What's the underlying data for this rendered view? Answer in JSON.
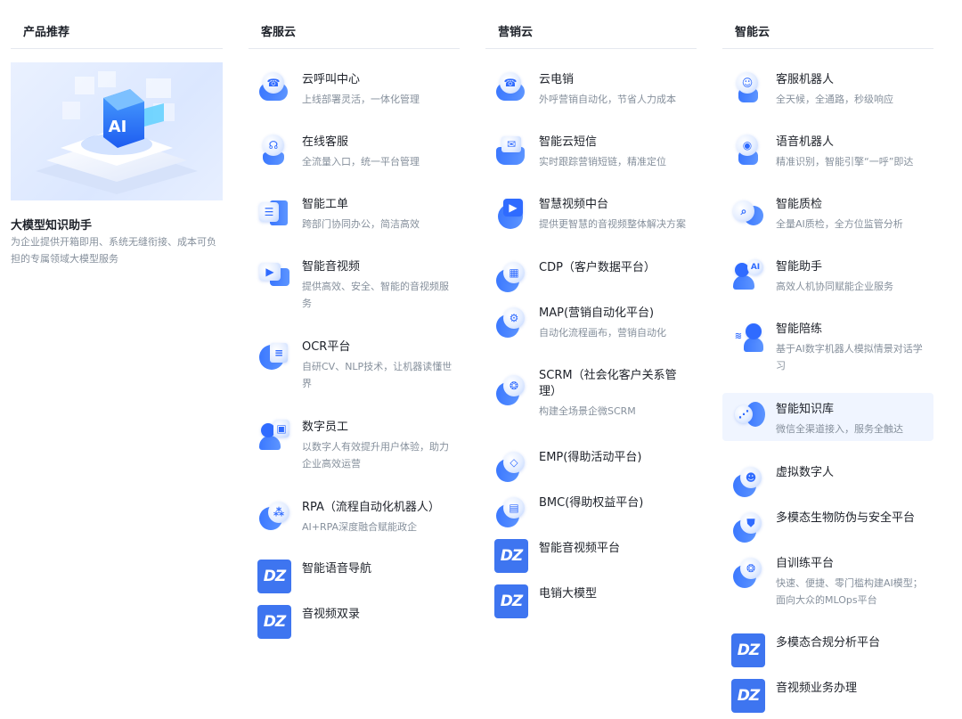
{
  "columns": {
    "recommend": {
      "title": "产品推荐",
      "hero": {
        "badge": "AI",
        "title": "大模型知识助手",
        "desc": "为企业提供开箱即用、系统无缝衔接、成本可负担的专属领域大模型服务"
      }
    },
    "service": {
      "title": "客服云",
      "items": [
        {
          "name": "云呼叫中心",
          "desc": "上线部署灵活，一体化管理",
          "icon": "phone-cloud-icon"
        },
        {
          "name": "在线客服",
          "desc": "全流量入口，统一平台管理",
          "icon": "headset-agent-icon"
        },
        {
          "name": "智能工单",
          "desc": "跨部门协同办公，简洁高效",
          "icon": "ticket-icon"
        },
        {
          "name": "智能音视频",
          "desc": "提供高效、安全、智能的音视频服务",
          "icon": "video-call-icon"
        },
        {
          "name": "OCR平台",
          "desc": "自研CV、NLP技术，让机器读懂世界",
          "icon": "document-scan-icon"
        },
        {
          "name": "数字员工",
          "desc": "以数字人有效提升用户体验，助力企业高效运营",
          "icon": "digital-employee-icon"
        },
        {
          "name": "RPA（流程自动化机器人）",
          "desc": "AI+RPA深度融合赋能政企",
          "icon": "robot-flow-icon"
        },
        {
          "name": "智能语音导航",
          "desc": "",
          "icon": "dz-logo-icon"
        },
        {
          "name": "音视频双录",
          "desc": "",
          "icon": "dz-logo-icon"
        }
      ]
    },
    "marketing": {
      "title": "营销云",
      "items": [
        {
          "name": "云电销",
          "desc": "外呼营销自动化，节省人力成本",
          "icon": "phone-cloud-icon"
        },
        {
          "name": "智能云短信",
          "desc": "实时跟踪营销短链，精准定位",
          "icon": "sms-icon"
        },
        {
          "name": "智慧视频中台",
          "desc": "提供更智慧的音视频整体解决方案",
          "icon": "video-platform-icon"
        },
        {
          "name": "CDP（客户数据平台）",
          "desc": "",
          "icon": "data-chart-icon"
        },
        {
          "name": "MAP(营销自动化平台)",
          "desc": "自动化流程画布，营销自动化",
          "icon": "automation-icon"
        },
        {
          "name": "SCRM（社会化客户关系管理）",
          "desc": "构建全场景企微SCRM",
          "icon": "social-network-icon"
        },
        {
          "name": "EMP(得助活动平台)",
          "desc": "",
          "icon": "diamond-icon"
        },
        {
          "name": "BMC(得助权益平台)",
          "desc": "",
          "icon": "gift-card-icon"
        },
        {
          "name": "智能音视频平台",
          "desc": "",
          "icon": "dz-logo-icon"
        },
        {
          "name": "电销大模型",
          "desc": "",
          "icon": "dz-logo-icon"
        }
      ]
    },
    "intelligent": {
      "title": "智能云",
      "items": [
        {
          "name": "客服机器人",
          "desc": "全天候，全通路，秒级响应",
          "icon": "service-robot-icon"
        },
        {
          "name": "语音机器人",
          "desc": "精准识别，智能引擎“一呼”即达",
          "icon": "voice-robot-icon"
        },
        {
          "name": "智能质检",
          "desc": "全量AI质检，全方位监管分析",
          "icon": "quality-check-icon"
        },
        {
          "name": "智能助手",
          "desc": "高效人机协同赋能企业服务",
          "icon": "ai-assistant-icon"
        },
        {
          "name": "智能陪练",
          "desc": "基于AI数字机器人模拟情景对话学习",
          "icon": "voice-training-icon"
        },
        {
          "name": "智能知识库",
          "desc": "微信全渠道接入，服务全触达",
          "icon": "knowledge-base-icon"
        },
        {
          "name": "虚拟数字人",
          "desc": "",
          "icon": "virtual-human-icon"
        },
        {
          "name": "多模态生物防伪与安全平台",
          "desc": "",
          "icon": "shield-icon"
        },
        {
          "name": "自训练平台",
          "desc": "快速、便捷、零门槛构建AI模型；面向大众的MLOps平台",
          "icon": "training-icon"
        },
        {
          "name": "多模态合规分析平台",
          "desc": "",
          "icon": "dz-logo-icon"
        },
        {
          "name": "音视频业务办理",
          "desc": "",
          "icon": "dz-logo-icon"
        }
      ]
    }
  },
  "logo_text": "DZ",
  "colors": {
    "accent": "#3e75f0",
    "active_bg": "#f0f5ff",
    "desc_text": "#86909c",
    "divider": "#e5e8ef"
  }
}
